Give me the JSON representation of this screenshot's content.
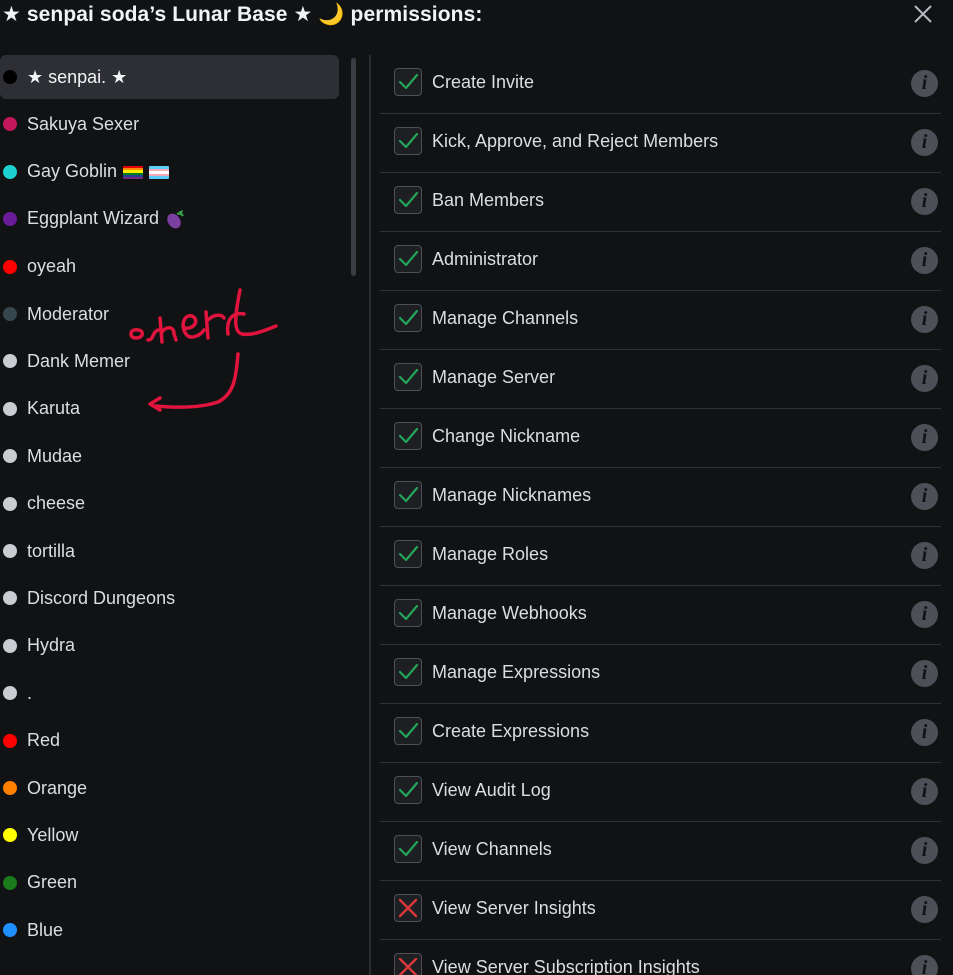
{
  "header": {
    "title": "★ senpai soda’s Lunar Base ★ 🌙 permissions:"
  },
  "annotation": {
    "text": "here"
  },
  "roles": [
    {
      "label": "★ senpai. ★",
      "color": "#000000",
      "selected": true
    },
    {
      "label": "Sakuya Sexer",
      "color": "#c2185b"
    },
    {
      "label": "Gay Goblin",
      "color": "#1ed0d0",
      "badges": [
        "pride-flag-icon",
        "trans-flag-icon"
      ]
    },
    {
      "label": "Eggplant Wizard",
      "color": "#6a1b9a",
      "badges": [
        "eggplant-icon"
      ]
    },
    {
      "label": "oyeah",
      "color": "#ff0000"
    },
    {
      "label": "Moderator",
      "color": "#37474f"
    },
    {
      "label": "Dank Memer",
      "color": "#c9ccd1"
    },
    {
      "label": "Karuta",
      "color": "#c9ccd1"
    },
    {
      "label": "Mudae",
      "color": "#c9ccd1"
    },
    {
      "label": "cheese",
      "color": "#c9ccd1"
    },
    {
      "label": "tortilla",
      "color": "#c9ccd1"
    },
    {
      "label": "Discord Dungeons",
      "color": "#c9ccd1"
    },
    {
      "label": "Hydra",
      "color": "#c9ccd1"
    },
    {
      "label": ".",
      "color": "#c9ccd1"
    },
    {
      "label": "Red",
      "color": "#ff0000"
    },
    {
      "label": "Orange",
      "color": "#ff7f00"
    },
    {
      "label": "Yellow",
      "color": "#ffff00"
    },
    {
      "label": "Green",
      "color": "#1b7a1b"
    },
    {
      "label": "Blue",
      "color": "#1e90ff"
    }
  ],
  "permissions": [
    {
      "label": "Create Invite",
      "checked": true
    },
    {
      "label": "Kick, Approve, and Reject Members",
      "checked": true
    },
    {
      "label": "Ban Members",
      "checked": true
    },
    {
      "label": "Administrator",
      "checked": true
    },
    {
      "label": "Manage Channels",
      "checked": true
    },
    {
      "label": "Manage Server",
      "checked": true
    },
    {
      "label": "Change Nickname",
      "checked": true
    },
    {
      "label": "Manage Nicknames",
      "checked": true
    },
    {
      "label": "Manage Roles",
      "checked": true
    },
    {
      "label": "Manage Webhooks",
      "checked": true
    },
    {
      "label": "Manage Expressions",
      "checked": true
    },
    {
      "label": "Create Expressions",
      "checked": true
    },
    {
      "label": "View Audit Log",
      "checked": true
    },
    {
      "label": "View Channels",
      "checked": true
    },
    {
      "label": "View Server Insights",
      "checked": false
    },
    {
      "label": "View Server Subscription Insights",
      "checked": false
    }
  ],
  "colors": {
    "check": "#23a55a",
    "cross": "#da373c",
    "annotation": "#e0143c"
  }
}
